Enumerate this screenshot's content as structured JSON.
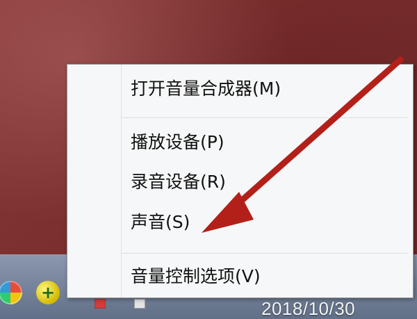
{
  "menu": {
    "items": [
      {
        "label": "打开音量合成器(M)"
      },
      {
        "label": "播放设备(P)"
      },
      {
        "label": "录音设备(R)"
      },
      {
        "label": "声音(S)"
      },
      {
        "label": "音量控制选项(V)"
      }
    ]
  },
  "taskbar": {
    "clock_date": "2018/10/30"
  },
  "icons": {
    "tray_colorful": "colorful-app-icon",
    "tray_plus": "plus-circle-icon"
  },
  "colors": {
    "arrow": "#b3201a",
    "desktop": "#7a2f2f"
  }
}
